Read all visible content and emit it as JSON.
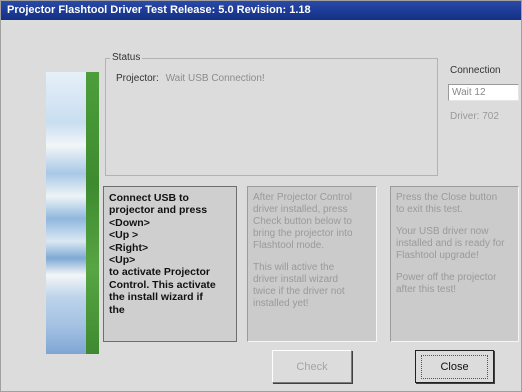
{
  "window": {
    "title": "Projector Flashtool Driver Test   Release: 5.0  Revision: 1.18"
  },
  "status": {
    "legend": "Status",
    "projector_label": "Projector:",
    "projector_value": "Wait USB Connection!"
  },
  "connection": {
    "label": "Connection",
    "value": "Wait 12",
    "driver_text": "Driver: 702"
  },
  "panels": {
    "instructions": "Connect USB to\nprojector and press\n<Down>\n<Up >\n<Right>\n<Up>\nto activate Projector\nControl. This activate\nthe install wizard if\nthe",
    "middle_1": "After Projector Control\ndriver installed, press\nCheck button below to\nbring the projector into\nFlashtool mode.",
    "middle_2": "This will active the\ndriver install wizard\ntwice if the driver not\ninstalled yet!",
    "right_1": "Press the Close button\nto exit this test.",
    "right_2": "Your USB driver now\ninstalled and is ready for\nFlashtool upgrade!",
    "right_3": "Power off the projector\nafter this test!"
  },
  "buttons": {
    "check": "Check",
    "close": "Close"
  }
}
